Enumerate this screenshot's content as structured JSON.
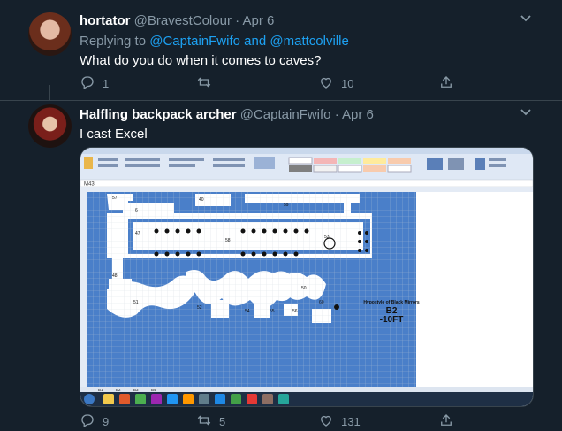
{
  "tweets": [
    {
      "name": "hortator",
      "handle": "@BravestColour",
      "date": "Apr 6",
      "replying_prefix": "Replying to",
      "reply_mention_1": "@CaptainFwifo",
      "reply_and": "and",
      "reply_mention_2": "@mattcolville",
      "text": "What do you do when it comes to caves?",
      "replies": "1",
      "retweets": "",
      "likes": "10"
    },
    {
      "name": "Halfling backpack archer",
      "handle": "@CaptainFwifo",
      "date": "Apr 6",
      "text": "I cast Excel",
      "replies": "9",
      "retweets": "5",
      "likes": "131"
    }
  ],
  "separator": "·",
  "icons": {
    "more": "chevron-down-icon",
    "reply": "reply-icon",
    "retweet": "retweet-icon",
    "like": "heart-icon",
    "share": "share-icon"
  },
  "media": {
    "sheet_title": "Hypostyle of Black Mirrors",
    "sheet_level": "B2",
    "sheet_depth": "-10FT",
    "cell_ref": "M43",
    "tabs": [
      "B1",
      "B2",
      "B3",
      "B4"
    ],
    "map_labels": [
      "57",
      "6",
      "40",
      "47",
      "58",
      "59",
      "53",
      "48",
      "50",
      "51",
      "52",
      "54",
      "55",
      "56",
      "60"
    ]
  },
  "colors": {
    "background": "#15202b",
    "text_secondary": "#8899a6",
    "link": "#1da1f2",
    "divider": "#38444d",
    "map_blue": "#4a7fc9"
  }
}
